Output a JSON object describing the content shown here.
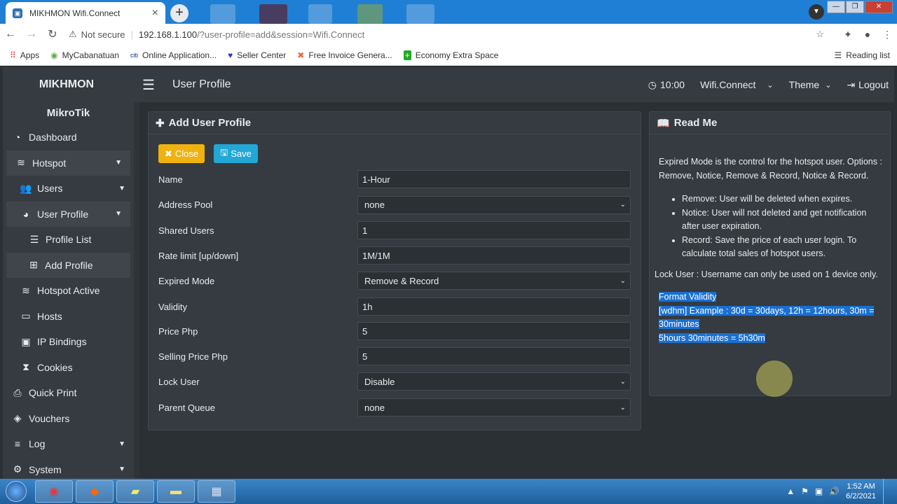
{
  "browser": {
    "tab_title": "MIKHMON Wifi.Connect",
    "tab_close": "×",
    "new_tab": "+",
    "not_secure": "Not secure",
    "url_host": "192.168.1.100",
    "url_path": "/?user-profile=add&session=Wifi.Connect",
    "bookmarks": [
      {
        "label": "Apps",
        "icon": "apps-grid-icon"
      },
      {
        "label": "MyCabanatuan",
        "icon": "site-icon"
      },
      {
        "label": "Online Application...",
        "icon": "citi-icon"
      },
      {
        "label": "Seller Center",
        "icon": "seller-icon"
      },
      {
        "label": "Free Invoice Genera...",
        "icon": "invoice-icon"
      },
      {
        "label": "Economy Extra Space",
        "icon": "plus-icon"
      }
    ],
    "reading_list": "Reading list"
  },
  "header": {
    "brand": "MIKHMON",
    "page_title": "User Profile",
    "clock": "10:00",
    "session": "Wifi.Connect",
    "theme": "Theme",
    "logout": "Logout"
  },
  "sidebar": {
    "title": "MikroTik",
    "items": [
      {
        "label": "Dashboard",
        "icon": "dashboard-icon"
      },
      {
        "label": "Hotspot",
        "icon": "wifi-icon"
      },
      {
        "label": "Users",
        "icon": "users-icon"
      },
      {
        "label": "User Profile",
        "icon": "pie-icon"
      },
      {
        "label": "Profile List",
        "icon": "list-icon"
      },
      {
        "label": "Add Profile",
        "icon": "plus-square-icon"
      },
      {
        "label": "Hotspot Active",
        "icon": "wifi-icon"
      },
      {
        "label": "Hosts",
        "icon": "laptop-icon"
      },
      {
        "label": "IP Bindings",
        "icon": "id-card-icon"
      },
      {
        "label": "Cookies",
        "icon": "hourglass-icon"
      },
      {
        "label": "Quick Print",
        "icon": "print-icon"
      },
      {
        "label": "Vouchers",
        "icon": "ticket-icon"
      },
      {
        "label": "Log",
        "icon": "align-icon"
      },
      {
        "label": "System",
        "icon": "gear-icon"
      }
    ]
  },
  "form": {
    "title": "Add User Profile",
    "close_label": "Close",
    "save_label": "Save",
    "fields": [
      {
        "label": "Name",
        "value": "1-Hour",
        "type": "text"
      },
      {
        "label": "Address Pool",
        "value": "none",
        "type": "select"
      },
      {
        "label": "Shared Users",
        "value": "1",
        "type": "text"
      },
      {
        "label": "Rate limit [up/down]",
        "value": "1M/1M",
        "type": "text"
      },
      {
        "label": "Expired Mode",
        "value": "Remove & Record",
        "type": "select"
      },
      {
        "label": "Validity",
        "value": "1h",
        "type": "text"
      },
      {
        "label": "Price Php",
        "value": "5",
        "type": "text"
      },
      {
        "label": "Selling Price Php",
        "value": "5",
        "type": "text"
      },
      {
        "label": "Lock User",
        "value": "Disable",
        "type": "select"
      },
      {
        "label": "Parent Queue",
        "value": "none",
        "type": "select"
      }
    ]
  },
  "readme": {
    "title": "Read Me",
    "intro": "Expired Mode is the control for the hotspot user. Options : Remove, Notice, Remove & Record, Notice & Record.",
    "bullets": [
      "Remove: User will be deleted when expires.",
      "Notice: User will not deleted and get notification after user expiration.",
      "Record: Save the price of each user login. To calculate total sales of hotspot users."
    ],
    "lock_note": "Lock User : Username can only be used on 1 device only.",
    "format_title": "Format Validity",
    "format_example": "[wdhm] Example : 30d = 30days, 12h = 12hours, 30m = 30minutes",
    "format_sample": "5hours 30minutes = 5h30m"
  },
  "taskbar": {
    "time": "1:52 AM",
    "date": "6/2/2021"
  },
  "colors": {
    "bg": "#2b3035",
    "panel": "#353b40",
    "close_btn": "#f0b20e",
    "save_btn": "#22a7d6",
    "highlight": "#1a6fd1"
  }
}
